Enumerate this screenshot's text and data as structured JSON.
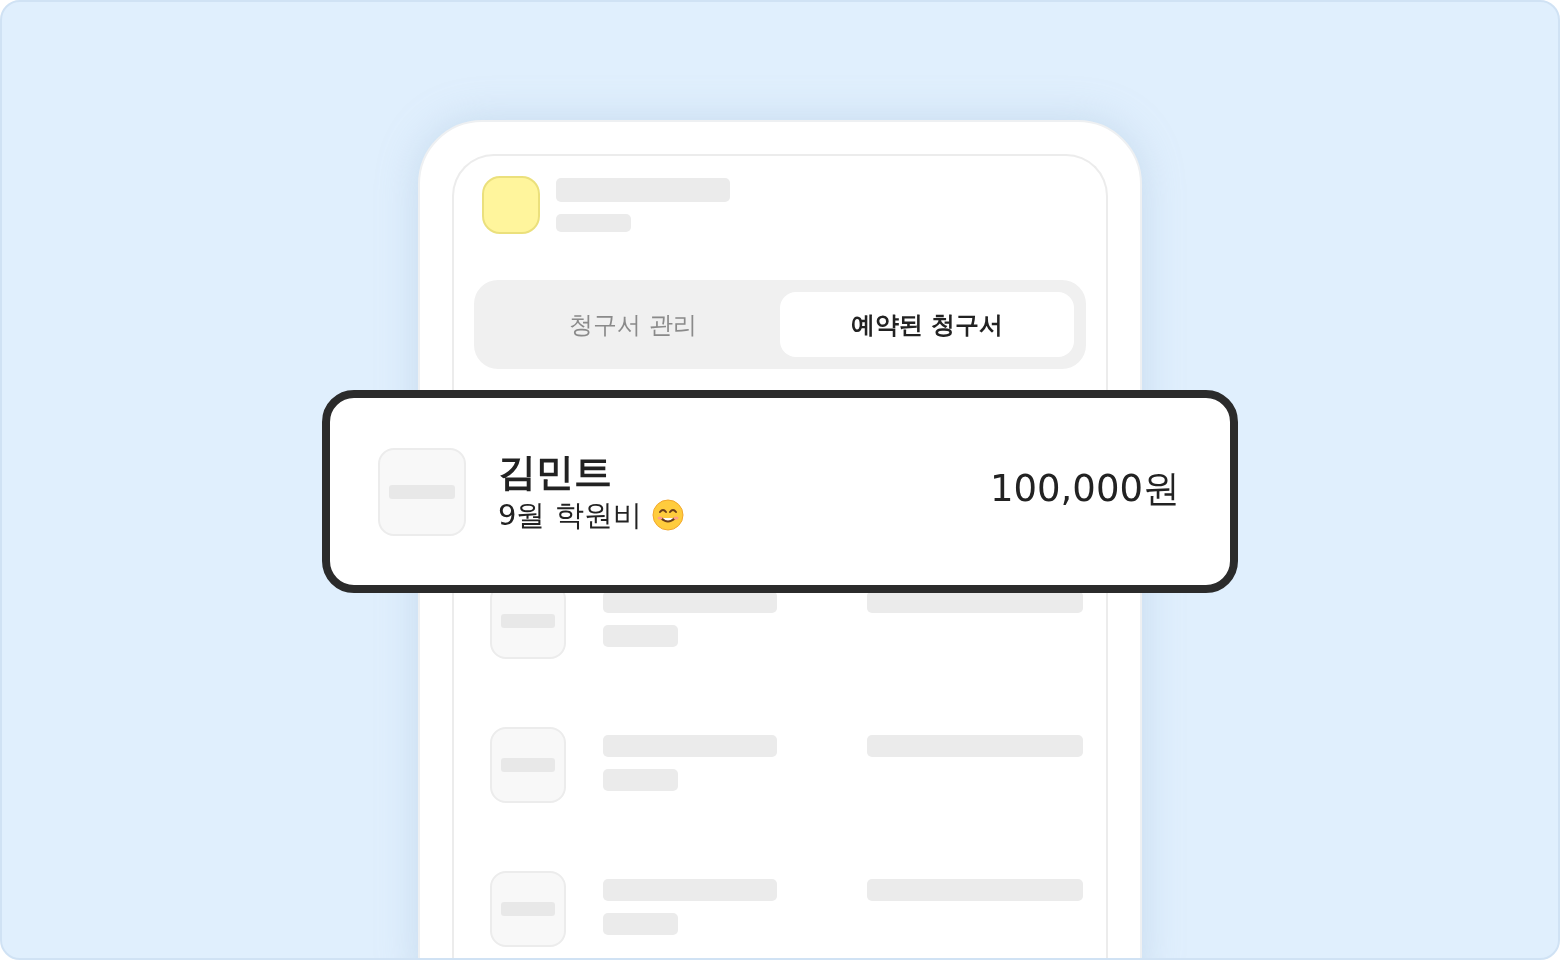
{
  "tabs": [
    {
      "label": "청구서 관리",
      "selected": false
    },
    {
      "label": "예약된 청구서",
      "selected": true
    }
  ],
  "highlight_card": {
    "name": "김민트",
    "subtitle": "9월 학원비",
    "amount": "100,000원"
  }
}
